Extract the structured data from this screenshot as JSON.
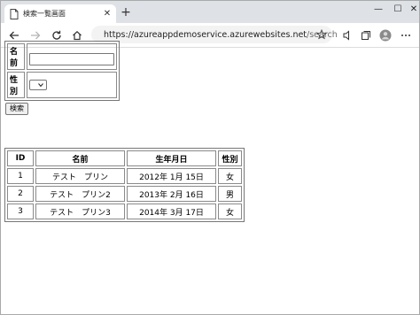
{
  "browser": {
    "tab_title": "検索一覧画面",
    "url_main": "https://azureappdemoservice.azurewebsites.net",
    "url_path": "/search"
  },
  "form": {
    "name_label": "名前",
    "name_value": "",
    "gender_label": "性別",
    "gender_value": "",
    "search_button": "検索"
  },
  "results": {
    "headers": [
      "ID",
      "名前",
      "生年月日",
      "性別"
    ],
    "rows": [
      [
        "1",
        "テスト　プリン",
        "2012年 1月 15日",
        "女"
      ],
      [
        "2",
        "テスト　プリン2",
        "2013年 2月 16日",
        "男"
      ],
      [
        "3",
        "テスト　プリン3",
        "2014年 3月 17日",
        "女"
      ]
    ]
  }
}
